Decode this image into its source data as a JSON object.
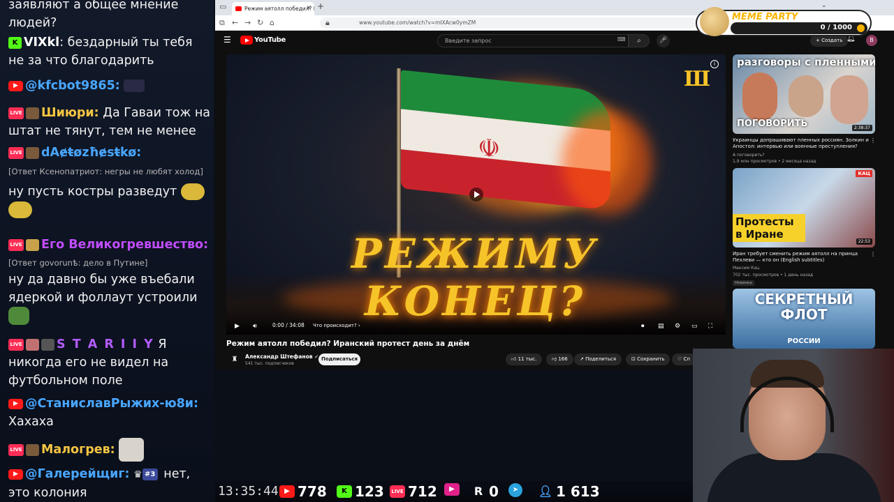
{
  "chat": {
    "messages": [
      {
        "top": 0,
        "text": "заявляют а общее мнение людей?"
      },
      {
        "badge": "kick",
        "name": "VIXkl",
        "name_color": "#ffffff",
        "text": "бездарный ты тебя не за что благодарить"
      },
      {
        "badge": "yt",
        "name": "@kfcbot9865:",
        "name_color": "#49a6ff",
        "text": ""
      },
      {
        "badge": "live",
        "name": "Шиюри:",
        "name_color": "#f5c542",
        "text": "Да Гаваи тож на штат не тянут, тем не менее"
      },
      {
        "badge": "live",
        "name": "dAɇŧøzħɇsŧkø:",
        "name_color": "#49a6ff",
        "reply": "[Ответ Ксенопатриот: негры не любят холод]",
        "text": "ну пусть костры разведут"
      },
      {
        "badge": "live",
        "name": "Его Великогревшество:",
        "name_color": "#c04cff",
        "reply": "[Ответ govorunѣ: дело в Путине]",
        "text": "ну да давно бы уже въебали ядеркой и фоллаут устроили"
      },
      {
        "badge": "live",
        "name": "S T A R I I Y",
        "name_color": "#b35cff",
        "text": "Я никогда его не видел на футбольном поле"
      },
      {
        "badge": "yt",
        "name": "@СтаниславРыжих-ю8и:",
        "name_color": "#49a6ff",
        "text": "Хахаха"
      },
      {
        "badge": "live",
        "name": "Малогрев:",
        "name_color": "#f5c542",
        "text": ""
      },
      {
        "badge": "yt",
        "name": "@Галерейщиг:",
        "name_color": "#49a6ff",
        "sub_badge": "#3",
        "text": "нет, это колония"
      }
    ]
  },
  "browser": {
    "tab_title": "Режим аятолл победил? Иран",
    "url": "www.youtube.com/watch?v=mIXAcw0ymZM"
  },
  "youtube": {
    "logo": "YouTube",
    "search_placeholder": "Введите запрос",
    "create_label": "Создать",
    "avatar_letter": "В",
    "video_overlay_title": "РЕЖИМУ КОНЕЦ?",
    "time_display": "0:00 / 34:08",
    "chapter": "Что происходит?",
    "video_title": "Режим аятолл победил? Иранский протест день за днём",
    "channel_name": "Александр Штефанов",
    "channel_subs": "541 тыс. подписчиков",
    "subscribe_label": "Подписаться",
    "likes": "11 тыс.",
    "dislikes": "166",
    "share_label": "Поделиться",
    "save_label": "Сохранить",
    "more_label": "Сп"
  },
  "recommendations": [
    {
      "thumb_text": "разговоры с пленными",
      "thumb_sub": "ПОГОВОРИТЬ",
      "duration": "2:38:37",
      "title": "Украинцы допрашивают пленных россиян. Золкин и Апостол: интервью или военные преступления?",
      "channel": "А поговорить?",
      "meta": "1,9 млн просмотров • 2 месяца назад"
    },
    {
      "thumb_text": "Протесты в Иране",
      "thumb_tag": "КАЦ",
      "duration": "22:53",
      "title": "Иран требует сменить режим аятолл на принца Пехлеви — кто он (English subtitles)",
      "channel": "Максим Кац",
      "meta": "702 тыс. просмотров • 1 день назад",
      "badge": "Новинка"
    },
    {
      "thumb_text": "СЕКРЕТНЫЙ ФЛОТ",
      "thumb_sub": "РОССИИ"
    }
  ],
  "meme_party": {
    "title": "MEME PARTY",
    "count": "0 / 1000",
    "progress": 0
  },
  "stats": {
    "time": "13:35:44",
    "youtube": "778",
    "kick": "123",
    "vk_live": "712",
    "rutube": "0",
    "telegram": "",
    "viewers": "1 613"
  }
}
